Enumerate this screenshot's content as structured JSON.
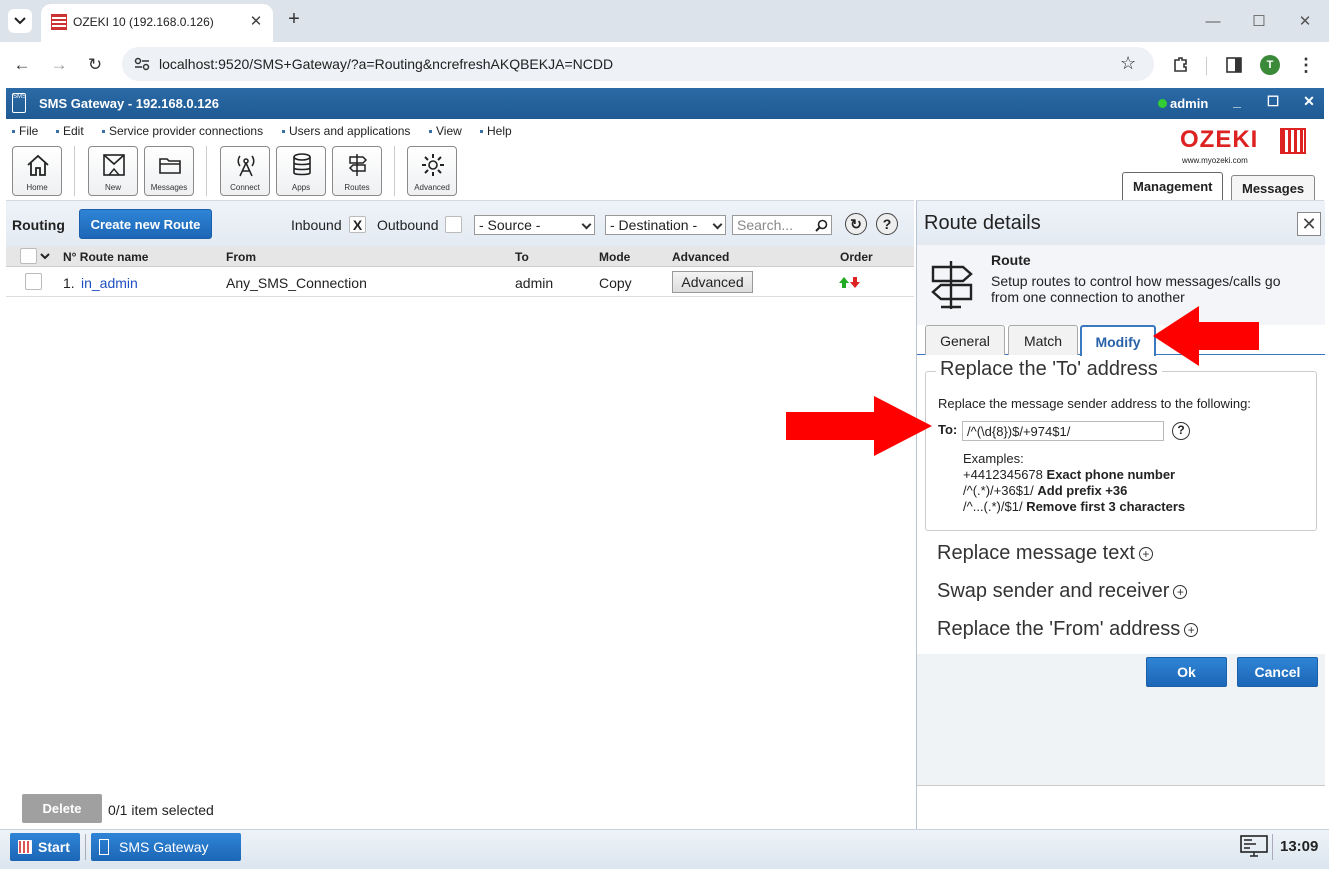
{
  "browser": {
    "tab_title": "OZEKI 10 (192.168.0.126)",
    "url": "localhost:9520/SMS+Gateway/?a=Routing&ncrefreshAKQBEKJA=NCDD",
    "profile_initial": "T"
  },
  "app": {
    "title": "SMS Gateway - 192.168.0.126",
    "user": "admin",
    "menu": [
      "File",
      "Edit",
      "Service provider connections",
      "Users and applications",
      "View",
      "Help"
    ],
    "logo_text": "OZEKI",
    "logo_sub": "www.myozeki.com",
    "toolbar": [
      {
        "label": "Home",
        "icon": "home-icon"
      },
      {
        "label": "New",
        "icon": "new-message-icon"
      },
      {
        "label": "Messages",
        "icon": "folder-icon"
      },
      {
        "label": "Connect",
        "icon": "antenna-icon"
      },
      {
        "label": "Apps",
        "icon": "database-icon"
      },
      {
        "label": "Routes",
        "icon": "signpost-icon"
      },
      {
        "label": "Advanced",
        "icon": "gear-icon"
      }
    ],
    "main_tabs": [
      "Management",
      "Messages"
    ]
  },
  "routing": {
    "title": "Routing",
    "create_button": "Create new Route",
    "inbound_label": "Inbound",
    "inbound_check": "X",
    "outbound_label": "Outbound",
    "source_select": "- Source -",
    "destination_select": "- Destination -",
    "search_placeholder": "Search...",
    "columns": [
      "N° Route name",
      "From",
      "To",
      "Mode",
      "Advanced",
      "Order"
    ],
    "rows": [
      {
        "num": "1.",
        "name": "in_admin",
        "from": "Any_SMS_Connection",
        "to": "admin",
        "mode": "Copy",
        "advanced": "Advanced"
      }
    ],
    "delete_button": "Delete",
    "selection_status": "0/1 item selected"
  },
  "route_details": {
    "title": "Route details",
    "info_title": "Route",
    "info_desc": "Setup routes to control how messages/calls go from one connection to another",
    "tabs": [
      "General",
      "Match",
      "Modify"
    ],
    "active_tab": "Modify",
    "replace_to": {
      "legend": "Replace the 'To' address",
      "desc": "Replace the message sender address to the following:",
      "field_label": "To:",
      "field_value": "/^(\\d{8})$/+974$1/",
      "examples_title": "Examples:",
      "examples": [
        {
          "code": "+4412345678",
          "desc": "Exact phone number"
        },
        {
          "code": "/^(.*)/+36$1/",
          "desc": "Add prefix +36"
        },
        {
          "code": "/^...(.*)/$1/",
          "desc": "Remove first 3 characters"
        }
      ]
    },
    "sections": [
      "Replace message text",
      "Swap sender and receiver",
      "Replace the 'From' address"
    ],
    "ok_button": "Ok",
    "cancel_button": "Cancel"
  },
  "taskbar": {
    "start": "Start",
    "task": "SMS Gateway",
    "clock": "13:09"
  }
}
